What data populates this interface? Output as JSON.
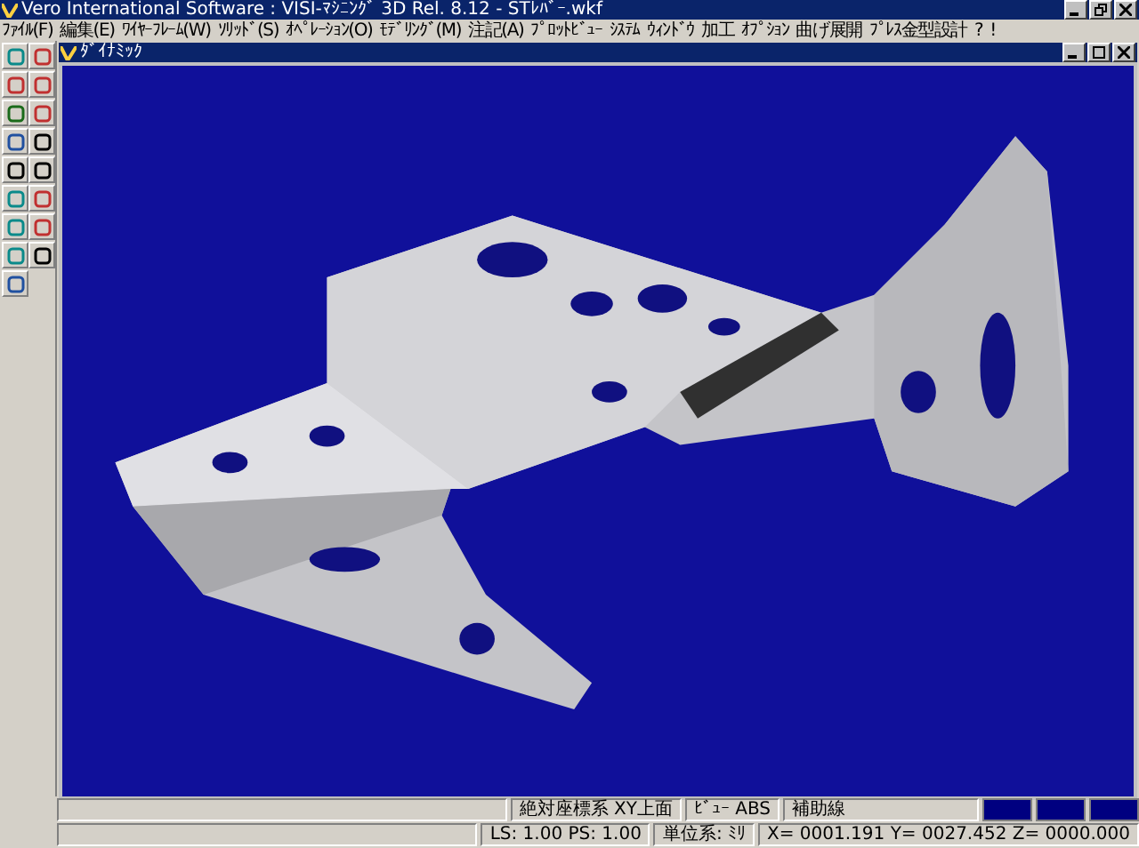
{
  "window": {
    "title": "Vero International Software : VISI-ﾏｼﾆﾝｸﾞ 3D Rel. 8.12 - STﾚﾊﾞｰ.wkf"
  },
  "menu": [
    "ﾌｧｲﾙ(F)",
    "編集(E)",
    "ﾜｲﾔｰﾌﾚｰﾑ(W)",
    "ｿﾘｯﾄﾞ(S)",
    "ｵﾍﾟﾚｰｼｮﾝ(O)",
    "ﾓﾃﾞﾘﾝｸﾞ(M)",
    "注記(A)",
    "ﾌﾟﾛｯﾄﾋﾞｭｰ",
    "ｼｽﾃﾑ",
    "ｳｨﾝﾄﾞｳ",
    "加工",
    "ｵﾌﾟｼｮﾝ",
    "曲げ展開",
    "ﾌﾟﾚｽ金型設計",
    "?",
    "!"
  ],
  "document": {
    "title": "ﾀﾞｲﾅﾐｯｸ"
  },
  "status_bar": {
    "row_1": [
      "絶対座標系 XY上面",
      "ﾋﾞｭｰ ABS",
      "補助線"
    ],
    "row_2": [
      "LS: 1.00 PS: 1.00",
      "単位系: ﾐﾘ",
      "X= 0001.191 Y= 0027.452 Z= 0000.000"
    ]
  }
}
